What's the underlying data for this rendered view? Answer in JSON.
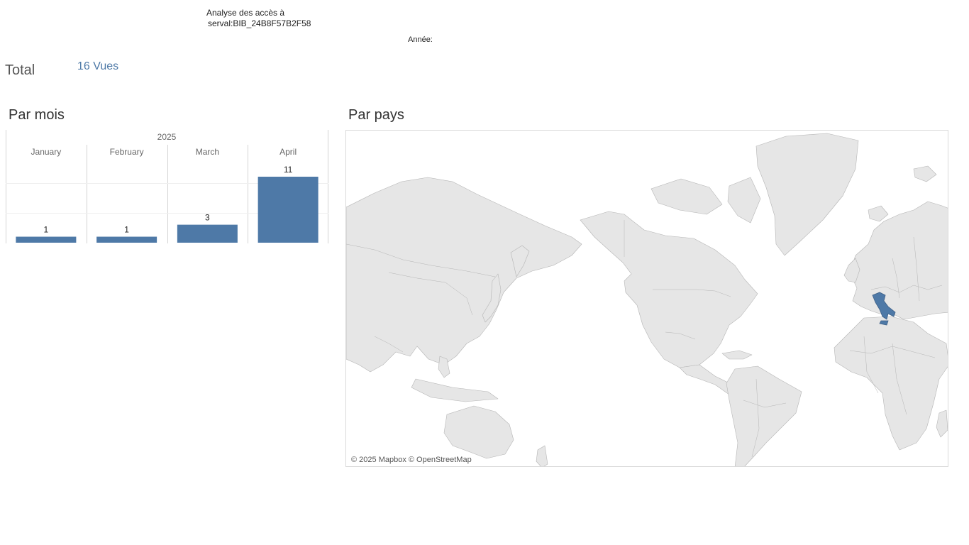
{
  "header": {
    "title_line1": "Analyse des accès à",
    "title_line2": "serval:BIB_24B8F57B2F58",
    "year_filter_label": "Année:"
  },
  "total": {
    "label": "Total",
    "value": "16 Vues"
  },
  "sections": {
    "by_month": "Par mois",
    "by_country": "Par pays"
  },
  "map": {
    "credit": "© 2025 Mapbox © OpenStreetMap",
    "highlighted_country": "Italy",
    "highlight_color": "#4e79a7",
    "land_color": "#e6e6e6",
    "border_color": "#b5b5b5"
  },
  "chart_data": {
    "type": "bar",
    "title": "",
    "group_label": "2025",
    "categories": [
      "January",
      "February",
      "March",
      "April"
    ],
    "values": [
      1,
      1,
      3,
      11
    ],
    "data_labels": [
      "1",
      "1",
      "3",
      "11"
    ],
    "ylim": [
      0,
      11
    ],
    "grid": true,
    "color": "#4e79a7"
  }
}
